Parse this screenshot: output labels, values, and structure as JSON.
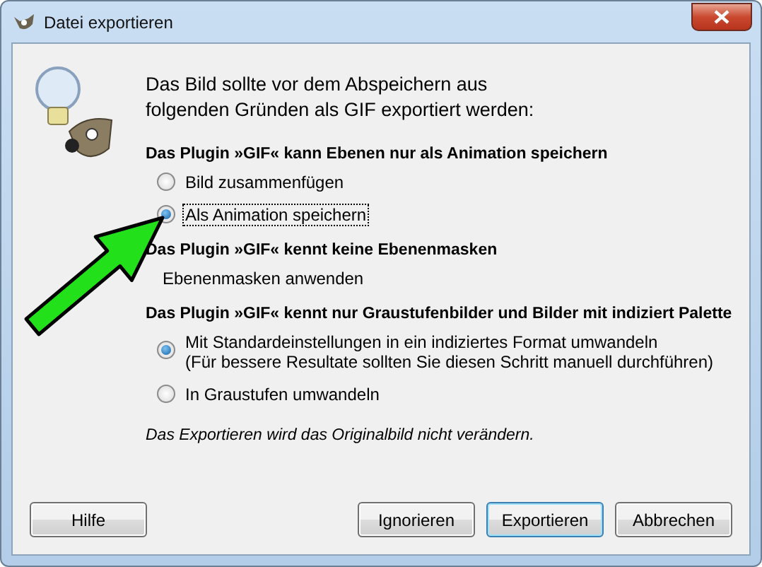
{
  "window": {
    "title": "Datei exportieren"
  },
  "intro": "Das Bild sollte vor dem Abspeichern aus folgenden Gründen als GIF exportiert werden:",
  "sections": [
    {
      "heading": "Das Plugin »GIF« kann Ebenen nur als Animation speichern",
      "options": [
        {
          "kind": "radio",
          "label": "Bild zusammenfügen",
          "selected": false,
          "focused": false
        },
        {
          "kind": "radio",
          "label": "Als Animation speichern",
          "selected": true,
          "focused": true
        }
      ]
    },
    {
      "heading": "Das Plugin »GIF« kennt keine Ebenenmasken",
      "options": [
        {
          "kind": "text",
          "label": "Ebenenmasken anwenden"
        }
      ]
    },
    {
      "heading": "Das Plugin »GIF« kennt nur Graustufenbilder und Bilder mit indiziert Palette",
      "options": [
        {
          "kind": "radio",
          "label": "Mit Standardeinstellungen in ein indiziertes Format umwandeln\n(Für bessere Resultate sollten Sie diesen Schritt manuell durchführen)",
          "selected": true,
          "focused": false
        },
        {
          "kind": "radio",
          "label": "In Graustufen umwandeln",
          "selected": false,
          "focused": false
        }
      ]
    }
  ],
  "note": "Das Exportieren wird das Originalbild nicht verändern.",
  "buttons": [
    {
      "label": "Hilfe",
      "default": false
    },
    {
      "label": "Ignorieren",
      "default": false
    },
    {
      "label": "Exportieren",
      "default": true
    },
    {
      "label": "Abbrechen",
      "default": false
    }
  ]
}
